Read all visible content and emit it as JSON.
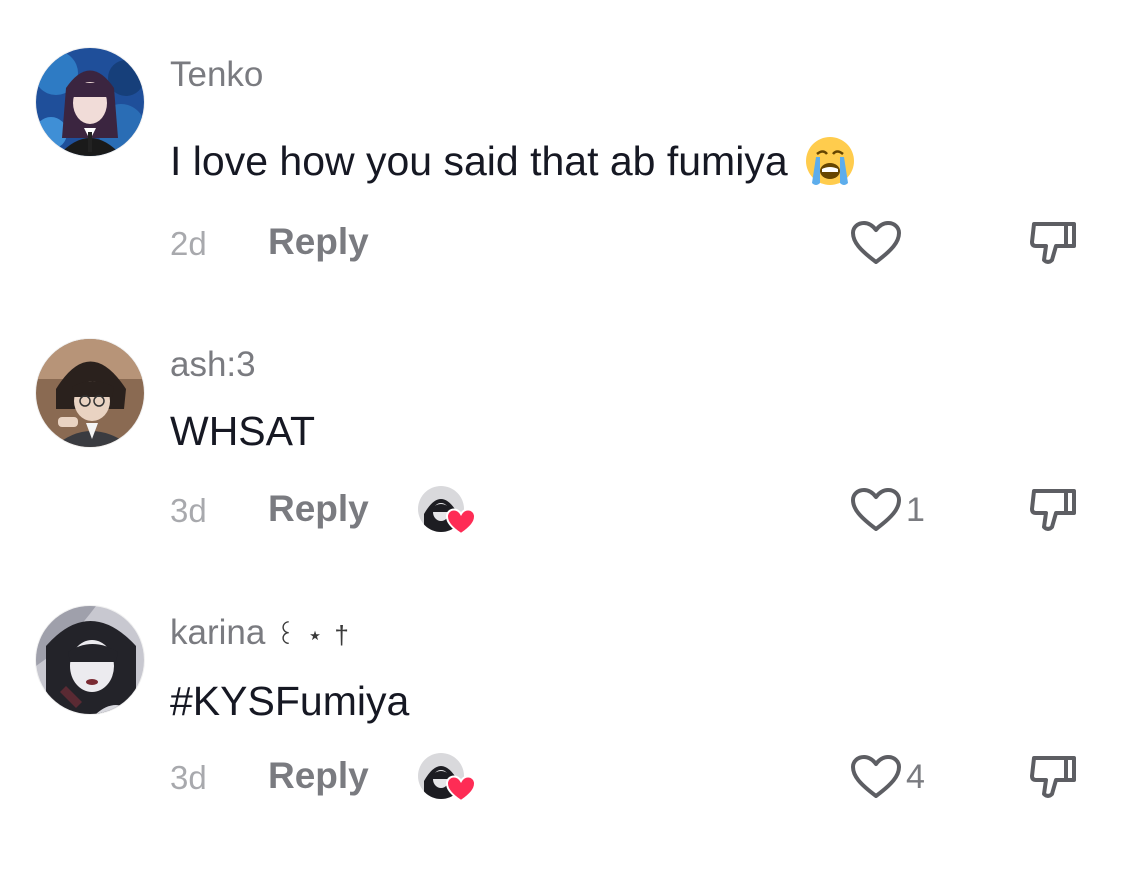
{
  "comments": [
    {
      "username": "Tenko",
      "username_decoration": "",
      "text": "I love how you said that ab fumiya",
      "emoji": "loudly-crying-face",
      "time": "2d",
      "reply_label": "Reply",
      "like_count": "",
      "liked_by_creator": false
    },
    {
      "username": "ash:3",
      "username_decoration": "",
      "text": "WHSAT",
      "emoji": "",
      "time": "3d",
      "reply_label": "Reply",
      "like_count": "1",
      "liked_by_creator": true
    },
    {
      "username": "karina",
      "username_decoration": "꒰ ⋆ †",
      "text": "#KYSFumiya",
      "emoji": "",
      "time": "3d",
      "reply_label": "Reply",
      "like_count": "4",
      "liked_by_creator": true
    }
  ],
  "colors": {
    "text_primary": "#161823",
    "text_secondary": "#7a7b80",
    "text_muted": "#a8a9ad",
    "creator_heart": "#fe2c55"
  },
  "icons": {
    "like": "heart-outline-icon",
    "dislike": "thumbs-down-outline-icon",
    "creator_like_badge": "heart-filled-icon"
  }
}
